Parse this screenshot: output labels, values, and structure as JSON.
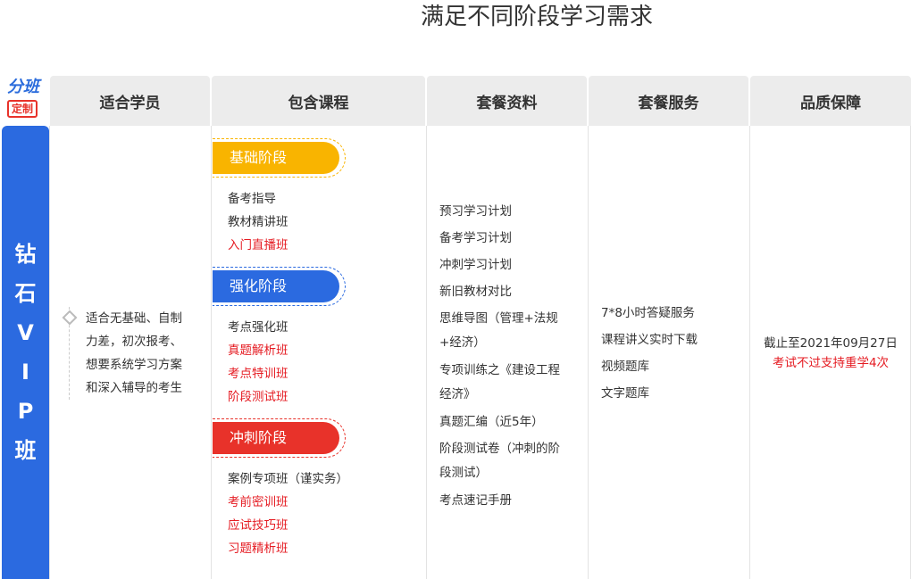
{
  "page_title": "满足不同阶段学习需求",
  "logo": {
    "line1": "分班",
    "line2": "定制"
  },
  "headers": [
    "适合学员",
    "包含课程",
    "套餐资料",
    "套餐服务",
    "品质保障"
  ],
  "side_label": [
    "钻",
    "石",
    "V",
    "I",
    "P",
    "班"
  ],
  "students_text": [
    "适合无基础、自制",
    "力差，初次报考、",
    "想要系统学习方案",
    "和深入辅导的考生"
  ],
  "stages": [
    {
      "label": "基础阶段",
      "color": "#f9b400",
      "courses": [
        {
          "text": "备考指导",
          "red": false
        },
        {
          "text": "教材精讲班",
          "red": false
        },
        {
          "text": "入门直播班",
          "red": true
        }
      ]
    },
    {
      "label": "强化阶段",
      "color": "#2b6ae0",
      "courses": [
        {
          "text": "考点强化班",
          "red": false
        },
        {
          "text": "真题解析班",
          "red": true
        },
        {
          "text": "考点特训班",
          "red": true
        },
        {
          "text": "阶段测试班",
          "red": true
        }
      ]
    },
    {
      "label": "冲刺阶段",
      "color": "#e8322a",
      "courses": [
        {
          "text": "案例专项班（谨实务）",
          "red": false
        },
        {
          "text": "考前密训班",
          "red": true
        },
        {
          "text": "应试技巧班",
          "red": true
        },
        {
          "text": "习题精析班",
          "red": true
        }
      ]
    }
  ],
  "materials": [
    "预习学习计划",
    "备考学习计划",
    "冲刺学习计划",
    "新旧教材对比",
    "思维导图（管理+法规",
    "+经济）",
    "专项训练之《建设工程",
    "经济》",
    "真题汇编（近5年）",
    "阶段测试卷（冲刺的阶",
    "段测试）",
    "考点速记手册"
  ],
  "services": [
    "7*8小时答疑服务",
    "课程讲义实时下载",
    "视频题库",
    "文字题库"
  ],
  "guarantee": {
    "line1": "截止至2021年09月27日",
    "line2": "考试不过支持重学4次"
  }
}
